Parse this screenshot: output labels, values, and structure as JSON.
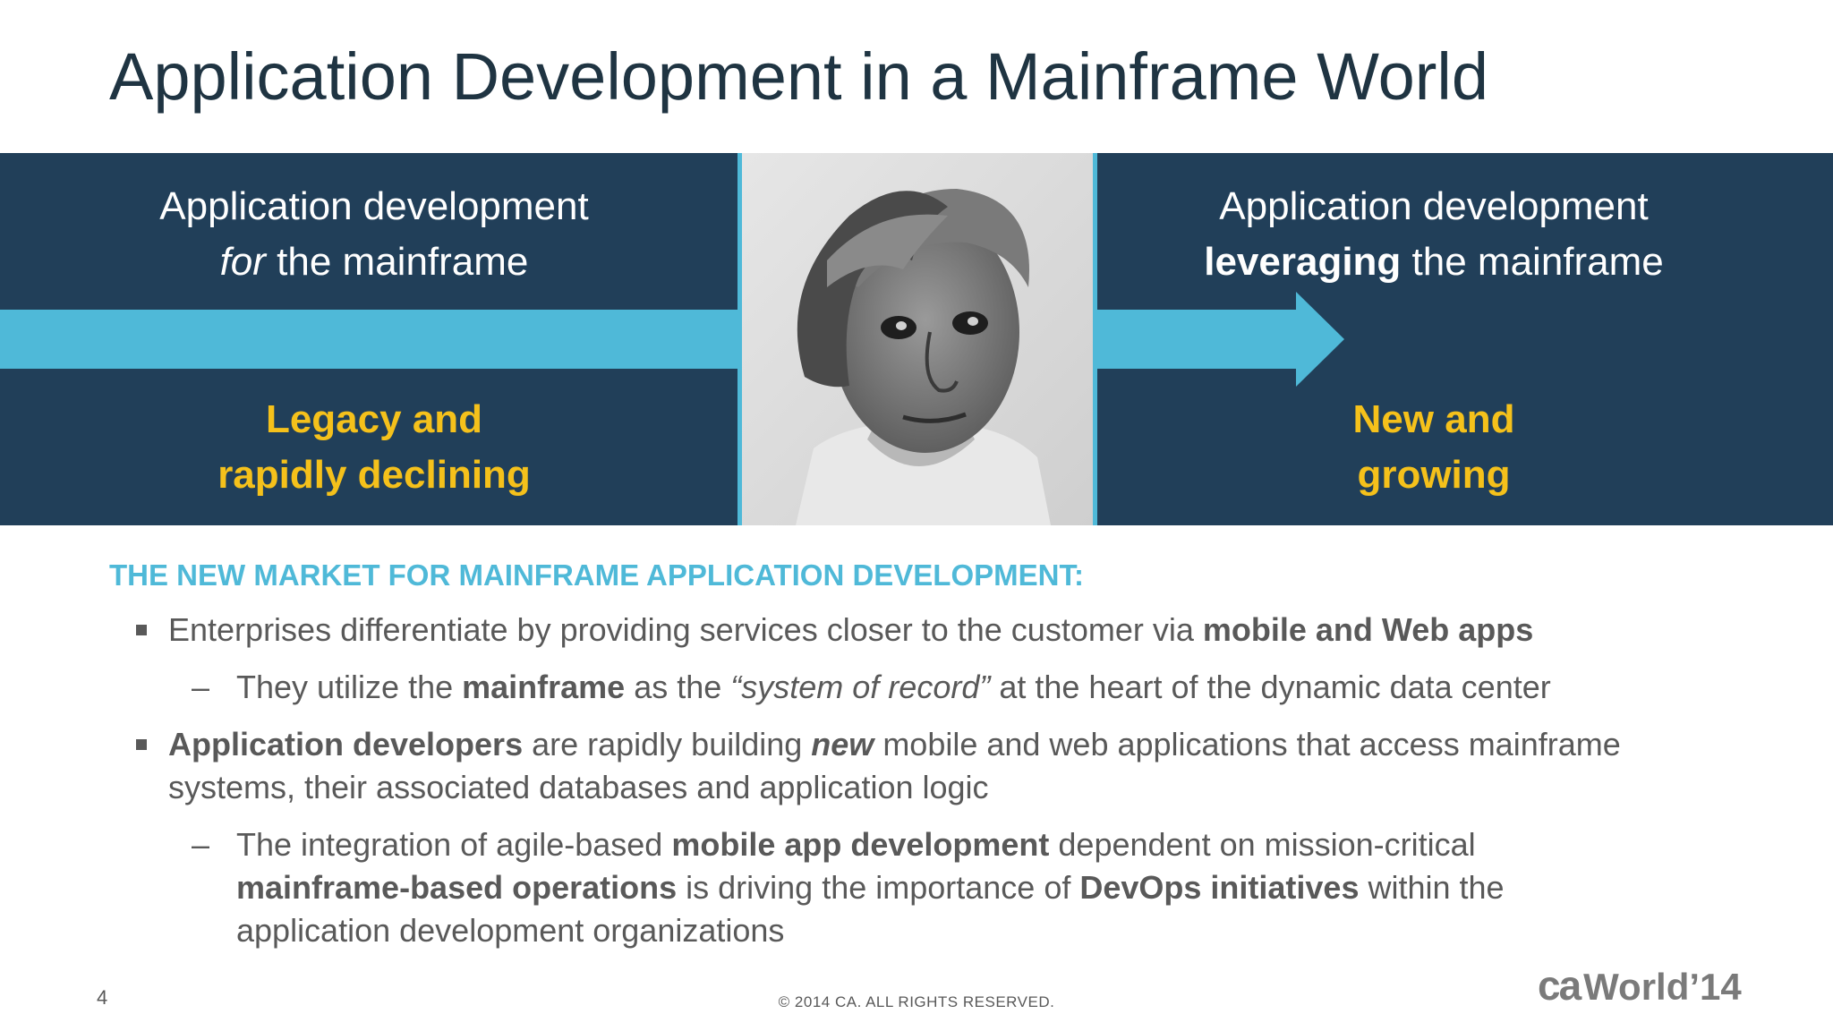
{
  "slide": {
    "title": "Application Development in a Mainframe World",
    "page_number": "4",
    "copyright": "© 2014 CA. ALL RIGHTS RESERVED."
  },
  "banner": {
    "left": {
      "line1": "Application development",
      "line2_em": "for",
      "line2_rest": " the mainframe",
      "status_line1": "Legacy and",
      "status_line2": "rapidly declining"
    },
    "right": {
      "line1": "Application development",
      "line2_bold": "leveraging",
      "line2_rest": " the mainframe",
      "status_line1": "New and",
      "status_line2": "growing"
    },
    "colors": {
      "navy": "#213f59",
      "arrow": "#4fb9d8",
      "status": "#f5c11b"
    }
  },
  "section": {
    "heading": "THE NEW MARKET FOR MAINFRAME APPLICATION DEVELOPMENT:",
    "b1": {
      "text": "Enterprises differentiate by providing services closer to the customer via ",
      "bold": "mobile and Web apps"
    },
    "b1_sub": {
      "dash": "–",
      "t1": "They utilize the ",
      "bold": "mainframe",
      "t2": " as the ",
      "italic": "“system of record”",
      "t3": " at the heart of the dynamic data center"
    },
    "b2": {
      "bold": "Application developers",
      "t1": " are rapidly building ",
      "bold_italic": "new",
      "t2": " mobile and web applications that access mainframe systems, their associated databases and application logic"
    },
    "b2_sub": {
      "dash": "–",
      "t1": "The integration of agile-based ",
      "bold1": "mobile app development",
      "t2": " dependent on mission-critical ",
      "bold2": "mainframe-based operations",
      "t3": " is driving the importance of ",
      "bold3": "DevOps initiatives",
      "t4": " within the application development organizations"
    }
  },
  "logo": {
    "brand": "ca",
    "word": "World",
    "year": "’14"
  }
}
